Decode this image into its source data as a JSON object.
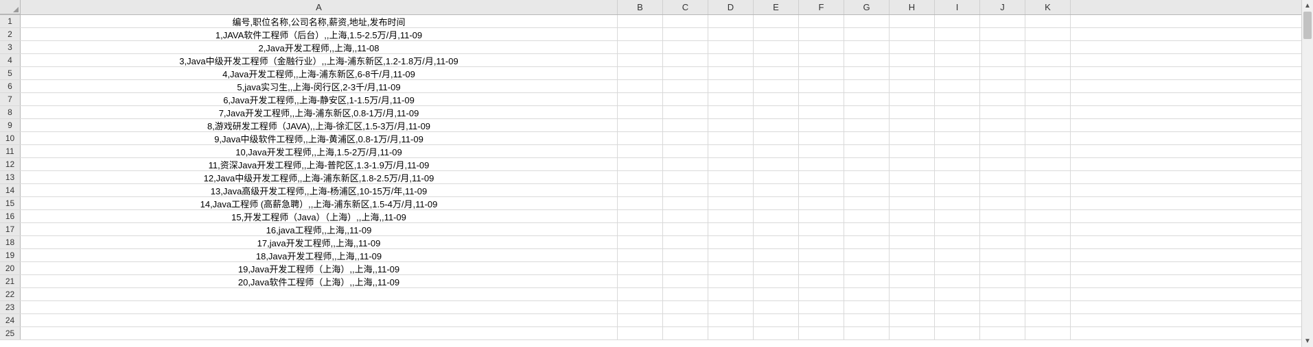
{
  "columns": [
    {
      "letter": "A",
      "cls": "col-A"
    },
    {
      "letter": "B",
      "cls": "col-std"
    },
    {
      "letter": "C",
      "cls": "col-std"
    },
    {
      "letter": "D",
      "cls": "col-std"
    },
    {
      "letter": "E",
      "cls": "col-std"
    },
    {
      "letter": "F",
      "cls": "col-std"
    },
    {
      "letter": "G",
      "cls": "col-std"
    },
    {
      "letter": "H",
      "cls": "col-std"
    },
    {
      "letter": "I",
      "cls": "col-std"
    },
    {
      "letter": "J",
      "cls": "col-std"
    },
    {
      "letter": "K",
      "cls": "col-std"
    }
  ],
  "rows": [
    {
      "n": "1",
      "A": "编号,职位名称,公司名称,薪资,地址,发布时间"
    },
    {
      "n": "2",
      "A": "1,JAVA软件工程师（后台）,,上海,1.5-2.5万/月,11-09"
    },
    {
      "n": "3",
      "A": "2,Java开发工程师,,上海,,11-08"
    },
    {
      "n": "4",
      "A": "3,Java中级开发工程师（金融行业）,,上海-浦东新区,1.2-1.8万/月,11-09"
    },
    {
      "n": "5",
      "A": "4,Java开发工程师,,上海-浦东新区,6-8千/月,11-09"
    },
    {
      "n": "6",
      "A": "5,java实习生,,上海-闵行区,2-3千/月,11-09"
    },
    {
      "n": "7",
      "A": "6,Java开发工程师,,上海-静安区,1-1.5万/月,11-09"
    },
    {
      "n": "8",
      "A": "7,Java开发工程师,,上海-浦东新区,0.8-1万/月,11-09"
    },
    {
      "n": "9",
      "A": "8,游戏研发工程师（JAVA),,上海-徐汇区,1.5-3万/月,11-09"
    },
    {
      "n": "10",
      "A": "9,Java中级软件工程师,,上海-黄浦区,0.8-1万/月,11-09"
    },
    {
      "n": "11",
      "A": "10,Java开发工程师,,上海,1.5-2万/月,11-09"
    },
    {
      "n": "12",
      "A": "11,资深Java开发工程师,,上海-普陀区,1.3-1.9万/月,11-09"
    },
    {
      "n": "13",
      "A": "12,Java中级开发工程师,,上海-浦东新区,1.8-2.5万/月,11-09"
    },
    {
      "n": "14",
      "A": "13,Java高级开发工程师,,上海-杨浦区,10-15万/年,11-09"
    },
    {
      "n": "15",
      "A": "14,Java工程师 (高薪急聘）,,上海-浦东新区,1.5-4万/月,11-09"
    },
    {
      "n": "16",
      "A": "15,开发工程师（Java）（上海）,,上海,,11-09"
    },
    {
      "n": "17",
      "A": "16,java工程师,,上海,,11-09"
    },
    {
      "n": "18",
      "A": "17,java开发工程师,,上海,,11-09"
    },
    {
      "n": "19",
      "A": "18,Java开发工程师,,上海,,11-09"
    },
    {
      "n": "20",
      "A": "19,Java开发工程师（上海）,,上海,,11-09"
    },
    {
      "n": "21",
      "A": "20,Java软件工程师（上海）,,上海,,11-09"
    },
    {
      "n": "22",
      "A": ""
    },
    {
      "n": "23",
      "A": ""
    },
    {
      "n": "24",
      "A": ""
    },
    {
      "n": "25",
      "A": ""
    }
  ],
  "scroll": {
    "up_glyph": "▲",
    "down_glyph": "▼"
  }
}
